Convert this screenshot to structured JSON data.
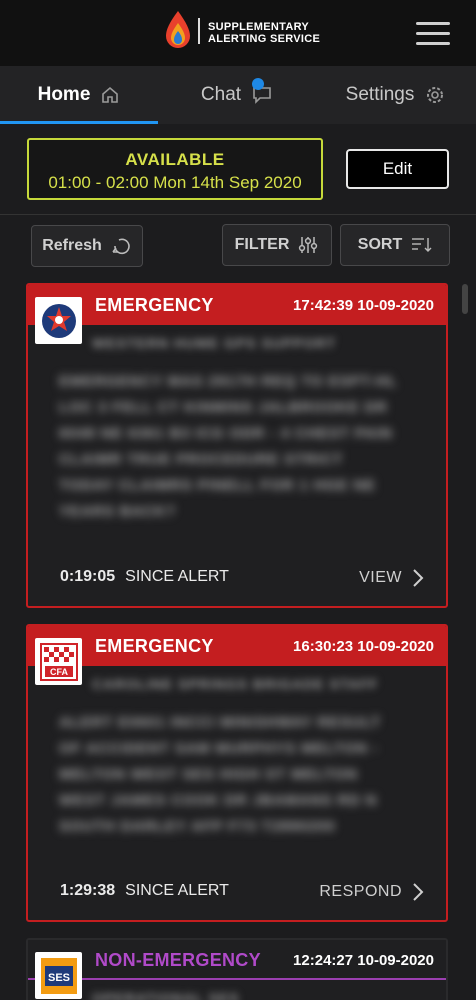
{
  "app": {
    "brand_line1": "SUPPLEMENTARY",
    "brand_line2": "ALERTING SERVICE"
  },
  "tabs": [
    {
      "label": "Home",
      "icon": "home-icon",
      "active": true
    },
    {
      "label": "Chat",
      "icon": "chat-icon",
      "active": false
    },
    {
      "label": "Settings",
      "icon": "gear-icon",
      "active": false
    }
  ],
  "availability": {
    "status": "AVAILABLE",
    "window": "01:00 - 02:00 Mon 14th Sep 2020",
    "edit_label": "Edit"
  },
  "toolbar": {
    "refresh_label": "Refresh",
    "filter_label": "FILTER",
    "sort_label": "SORT"
  },
  "alerts": [
    {
      "type": "EMERGENCY",
      "timestamp": "17:42:39 10-09-2020",
      "subtitle": "WESTERN HUME GPS SUPPORT",
      "body": "EMERGENCY MAS 2917H REQ TO ESPT-HL LOC 3 FELL CT KINMINS JALBROOKE DR 6048 NE 6361 B3 ICG ODR - 4 CHEST PAIN CLAIMR TRUE PROCEDURE STRICT TODAY CLAIMRS PINELL FOR 1 HGE NE YEARS BACK?",
      "since_time": "0:19:05",
      "since_label": "SINCE ALERT",
      "action_label": "VIEW",
      "badge": "ambulance-badge-icon"
    },
    {
      "type": "EMERGENCY",
      "timestamp": "16:30:23 10-09-2020",
      "subtitle": "CAROLINE SPRINGS BRIGADE STAFF",
      "body": "ALERT E0601 INCCI MINISHWAY RESULT OF ACCIDENT SAM MURPHYS MELTON - MELTON WEST SES HIGH ST MELTON WEST JAMES COOK DR JBAMANS RD N SOUTH DARLEY AFP F73 T2890200",
      "since_time": "1:29:38",
      "since_label": "SINCE ALERT",
      "action_label": "RESPOND",
      "badge": "cfa-badge-icon",
      "badge_text": "CFA"
    },
    {
      "type": "NON-EMERGENCY",
      "timestamp": "12:24:27 10-09-2020",
      "subtitle": "OPERATIONAL SES",
      "badge": "ses-badge-icon",
      "badge_text": "SES"
    }
  ],
  "colors": {
    "emergency": "#c41e20",
    "non_emergency": "#b04ac9",
    "available": "#d6e04a",
    "accent": "#2196f3"
  }
}
